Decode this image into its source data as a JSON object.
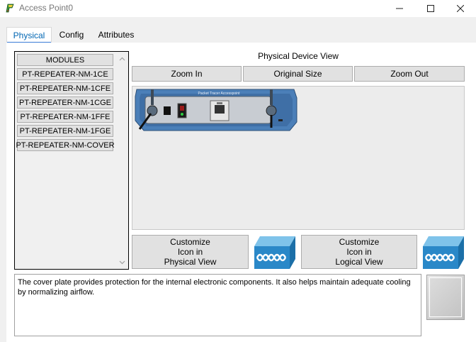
{
  "window": {
    "title": "Access Point0"
  },
  "tabs": [
    {
      "label": "Physical"
    },
    {
      "label": "Config"
    },
    {
      "label": "Attributes"
    }
  ],
  "modules": {
    "header": "MODULES",
    "items": [
      "PT-REPEATER-NM-1CE",
      "PT-REPEATER-NM-1CFE",
      "PT-REPEATER-NM-1CGE",
      "PT-REPEATER-NM-1FFE",
      "PT-REPEATER-NM-1FGE",
      "PT-REPEATER-NM-COVER"
    ]
  },
  "device_view": {
    "title": "Physical Device View",
    "zoom_in": "Zoom In",
    "original_size": "Original Size",
    "zoom_out": "Zoom Out",
    "device_label": "Packet Tracer Accesspoint"
  },
  "customize": {
    "physical": [
      "Customize",
      "Icon in",
      "Physical View"
    ],
    "logical": [
      "Customize",
      "Icon in",
      "Logical View"
    ]
  },
  "description": "The cover plate provides protection for the internal electronic components. It also helps maintain adequate cooling by normalizing airflow.",
  "colors": {
    "active_tab": "#0066b3",
    "tab_underline": "#3a7cd6",
    "device_body": "#4b7fb8",
    "icon_blue": "#2a88c8"
  }
}
